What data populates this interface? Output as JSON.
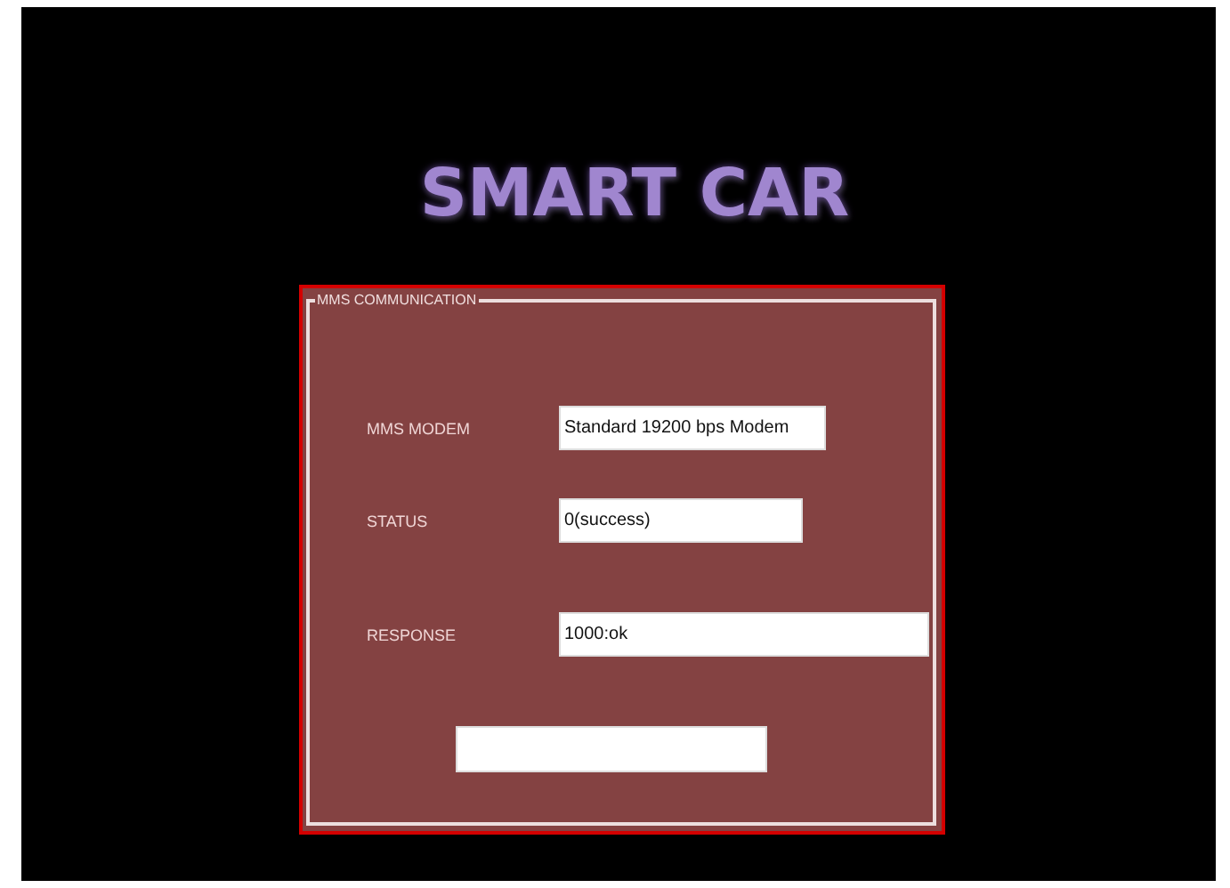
{
  "title": "SMART CAR",
  "group": {
    "legend": "MMS COMMUNICATION",
    "fields": [
      {
        "label": "MMS MODEM",
        "value": "Standard 19200 bps Modem",
        "kind": "medium"
      },
      {
        "label": "STATUS",
        "value": "0(success)",
        "kind": "short"
      },
      {
        "label": "RESPONSE",
        "value": "1000:ok",
        "kind": "long"
      }
    ]
  }
}
